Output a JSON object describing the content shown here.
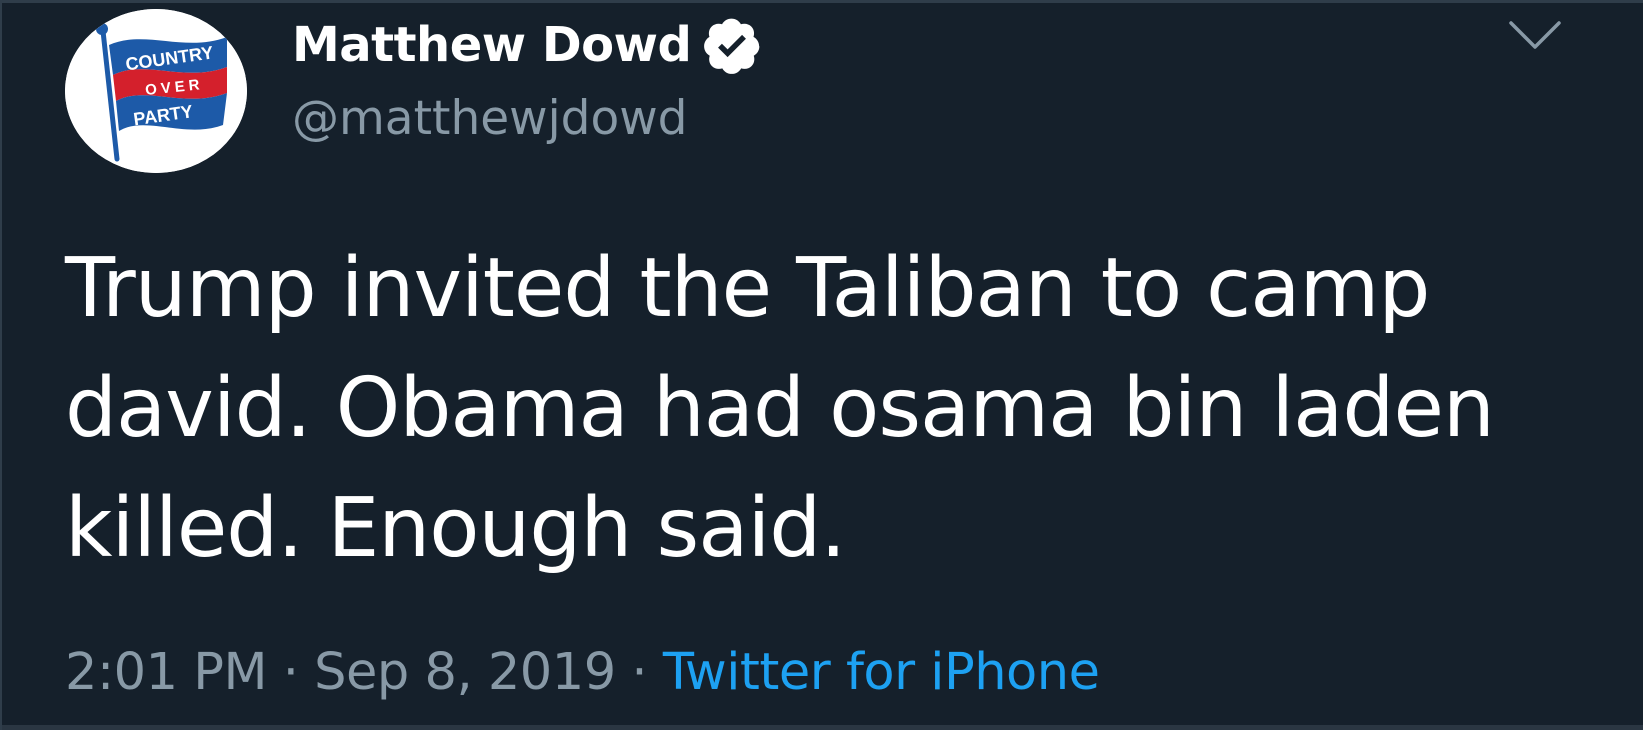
{
  "tweet": {
    "author": {
      "display_name": "Matthew Dowd",
      "handle": "@matthewjdowd",
      "verified": true,
      "avatar": {
        "icon": "country-over-party-flag-avatar",
        "words": [
          "COUNTRY",
          "OVER",
          "PARTY"
        ]
      }
    },
    "text": "Trump invited the Taliban to camp\ndavid.  Obama had osama bin laden\nkilled.  Enough said.",
    "time": "2:01 PM",
    "separator": "·",
    "date": "Sep 8, 2019",
    "source": "Twitter for iPhone"
  },
  "icons": {
    "verified": "verified-badge-icon",
    "caret": "chevron-down-icon"
  },
  "colors": {
    "background": "#15202b",
    "text_primary": "#ffffff",
    "text_secondary": "#8899a6",
    "link": "#1da1f2",
    "avatar_flag_blue": "#1d5aa8",
    "avatar_flag_red": "#d4202c"
  }
}
